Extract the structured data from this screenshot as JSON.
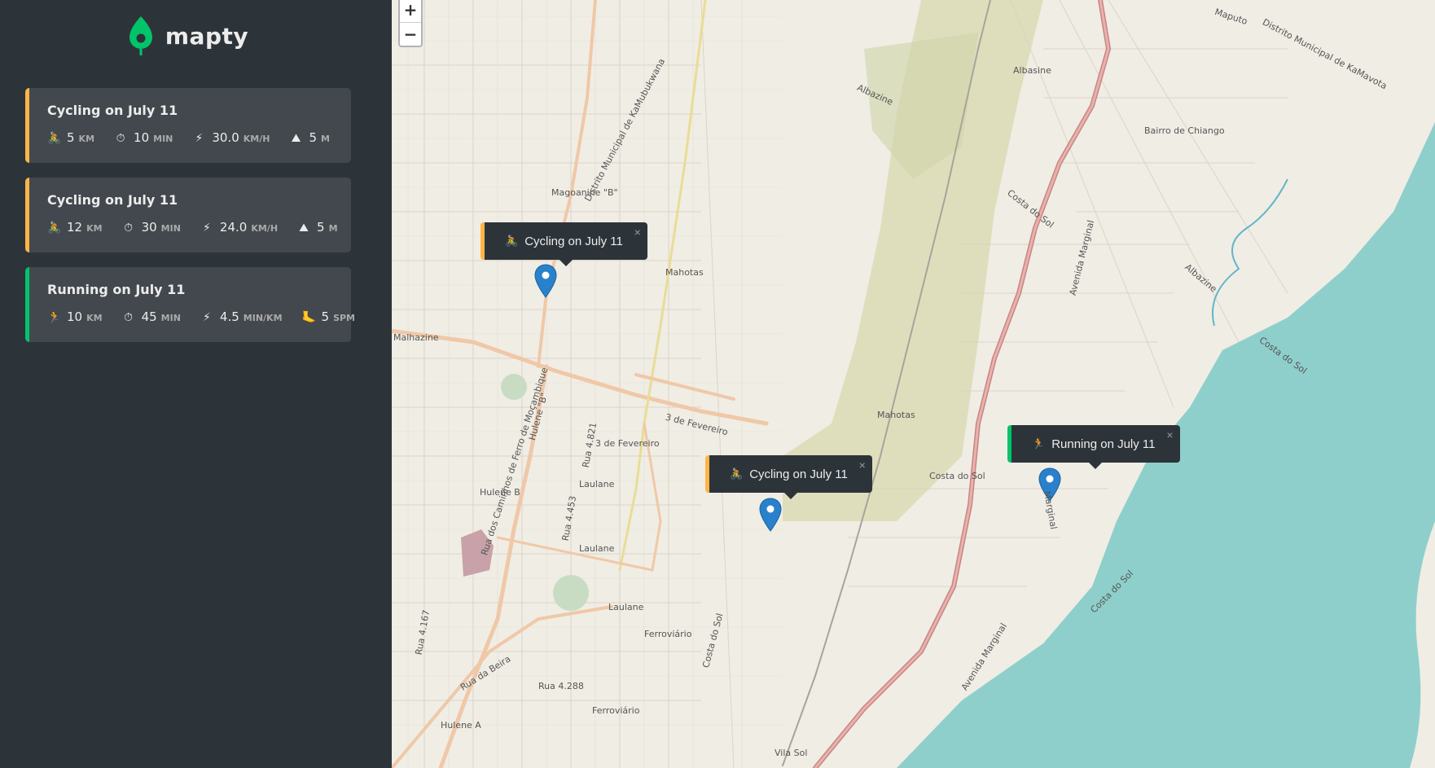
{
  "brand": {
    "name": "mapty",
    "color": "#00c46a"
  },
  "workouts": [
    {
      "type": "cycling",
      "title": "Cycling on July 11",
      "icon": "🚴",
      "distance": "5",
      "distance_unit": "km",
      "duration": "10",
      "duration_unit": "min",
      "speed": "30.0",
      "speed_unit": "km/h",
      "extra": "5",
      "extra_unit": "m",
      "extra_icon": "⛰"
    },
    {
      "type": "cycling",
      "title": "Cycling on July 11",
      "icon": "🚴",
      "distance": "12",
      "distance_unit": "km",
      "duration": "30",
      "duration_unit": "min",
      "speed": "24.0",
      "speed_unit": "km/h",
      "extra": "5",
      "extra_unit": "m",
      "extra_icon": "⛰"
    },
    {
      "type": "running",
      "title": "Running on July 11",
      "icon": "🏃",
      "distance": "10",
      "distance_unit": "km",
      "duration": "45",
      "duration_unit": "min",
      "speed": "4.5",
      "speed_unit": "min/km",
      "extra": "5",
      "extra_unit": "spm",
      "extra_icon": "🦶"
    }
  ],
  "icons": {
    "duration": "⏱",
    "speed": "⚡"
  },
  "map": {
    "zoom_in": "+",
    "zoom_out": "−",
    "popups": [
      {
        "type": "cycling",
        "icon": "🚴",
        "label": "Cycling on July 11"
      },
      {
        "type": "cycling",
        "icon": "🚴",
        "label": "Cycling on July 11"
      },
      {
        "type": "running",
        "icon": "🏃",
        "label": "Running on July 11"
      }
    ],
    "close_glyph": "×",
    "labels": [
      "Magoanine \"B\"",
      "Distrito Municipal de KaMubukwana",
      "Mahotas",
      "Mahotas",
      "Albazine",
      "Albasine",
      "Maputo",
      "Distrito Municipal de KaMavota",
      "Bairro de Chiango",
      "Costa do Sol",
      "Avenida Marginal",
      "Albazine",
      "Costa do Sol",
      "Malhazine",
      "Hulene \"B\"",
      "Rua 4.821",
      "3 de Fevereiro",
      "3 de Fevereiro",
      "Laulane",
      "Rua 4.453",
      "Hulene B",
      "Laulane",
      "Laulane",
      "Ferroviário",
      "Rua da Beira",
      "Rua 4.288",
      "Ferroviário",
      "Hulene A",
      "Vila Sol",
      "Costa do Sol",
      "Costa do Sol",
      "Marginal",
      "Avenida Marginal",
      "Rua 4.167",
      "Rua dos Caminhos de Ferro de Moçambique",
      "Costa do Sol"
    ]
  }
}
